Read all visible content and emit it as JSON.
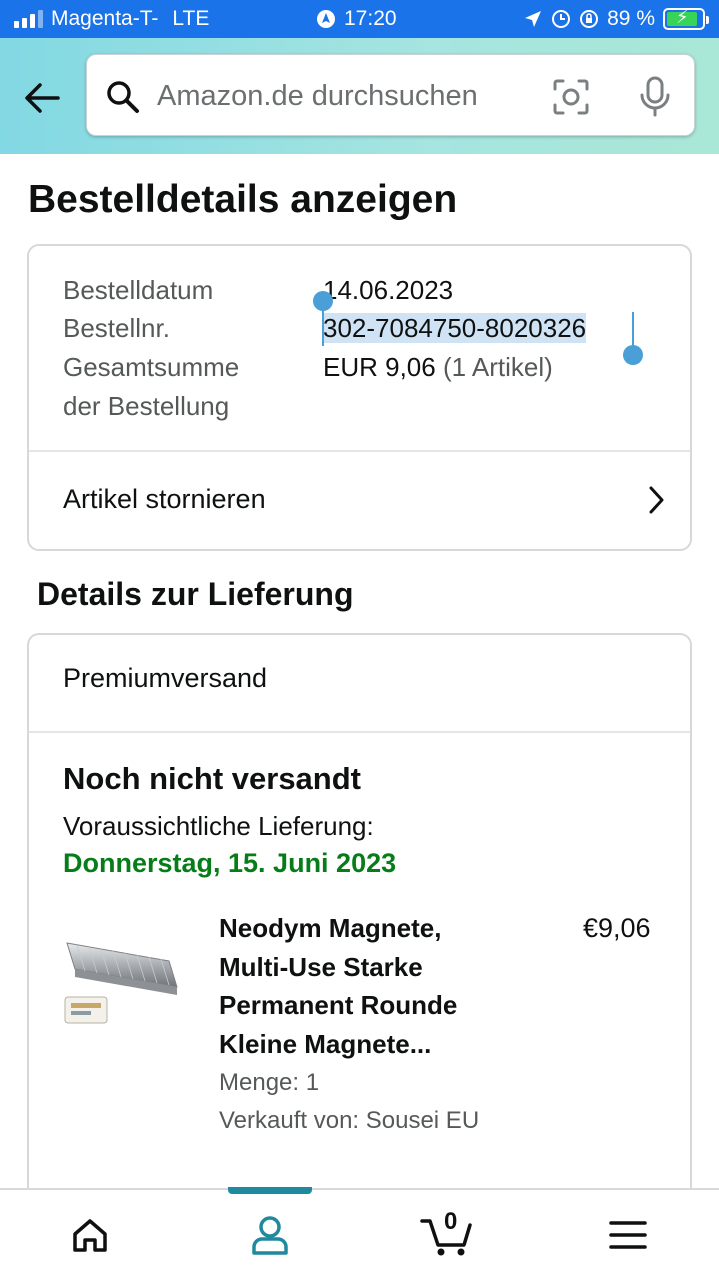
{
  "status_bar": {
    "carrier": "Magenta-T-",
    "network": "LTE",
    "time": "17:20",
    "battery": "89 %",
    "battery_level": 0.89
  },
  "search": {
    "placeholder": "Amazon.de durchsuchen"
  },
  "page": {
    "title": "Bestelldetails anzeigen"
  },
  "order_summary": {
    "date_label": "Bestelldatum",
    "date_value": "14.06.2023",
    "number_label": "Bestellnr.",
    "number_value": "302-7084750-8020326",
    "total_label_line1": "Gesamtsumme",
    "total_label_line2": "der Bestellung",
    "total_value": "EUR 9,06",
    "total_items": "(1 Artikel)",
    "cancel_label": "Artikel stornieren"
  },
  "delivery": {
    "section_title": "Details zur Lieferung",
    "shipping_type": "Premiumversand",
    "status": "Noch nicht versandt",
    "eta_label": "Voraussichtliche Lieferung:",
    "eta_date": "Donnerstag, 15. Juni 2023",
    "item": {
      "name_line1": "Neodym Magnete,",
      "name_line2": "Multi-Use Starke",
      "name_line3": "Permanent Rounde",
      "name_line4": "Kleine Magnete...",
      "price": "€9,06",
      "quantity": "Menge: 1",
      "seller": "Verkauft von: Sousei EU"
    }
  },
  "bottom_nav": {
    "cart_count": "0",
    "active": "account"
  },
  "colors": {
    "status_bar": "#1a73e8",
    "eta_green": "#067d18",
    "selection": "#cfe3f5",
    "handle": "#4a9fd6",
    "nav_active": "#1f8a9d"
  }
}
